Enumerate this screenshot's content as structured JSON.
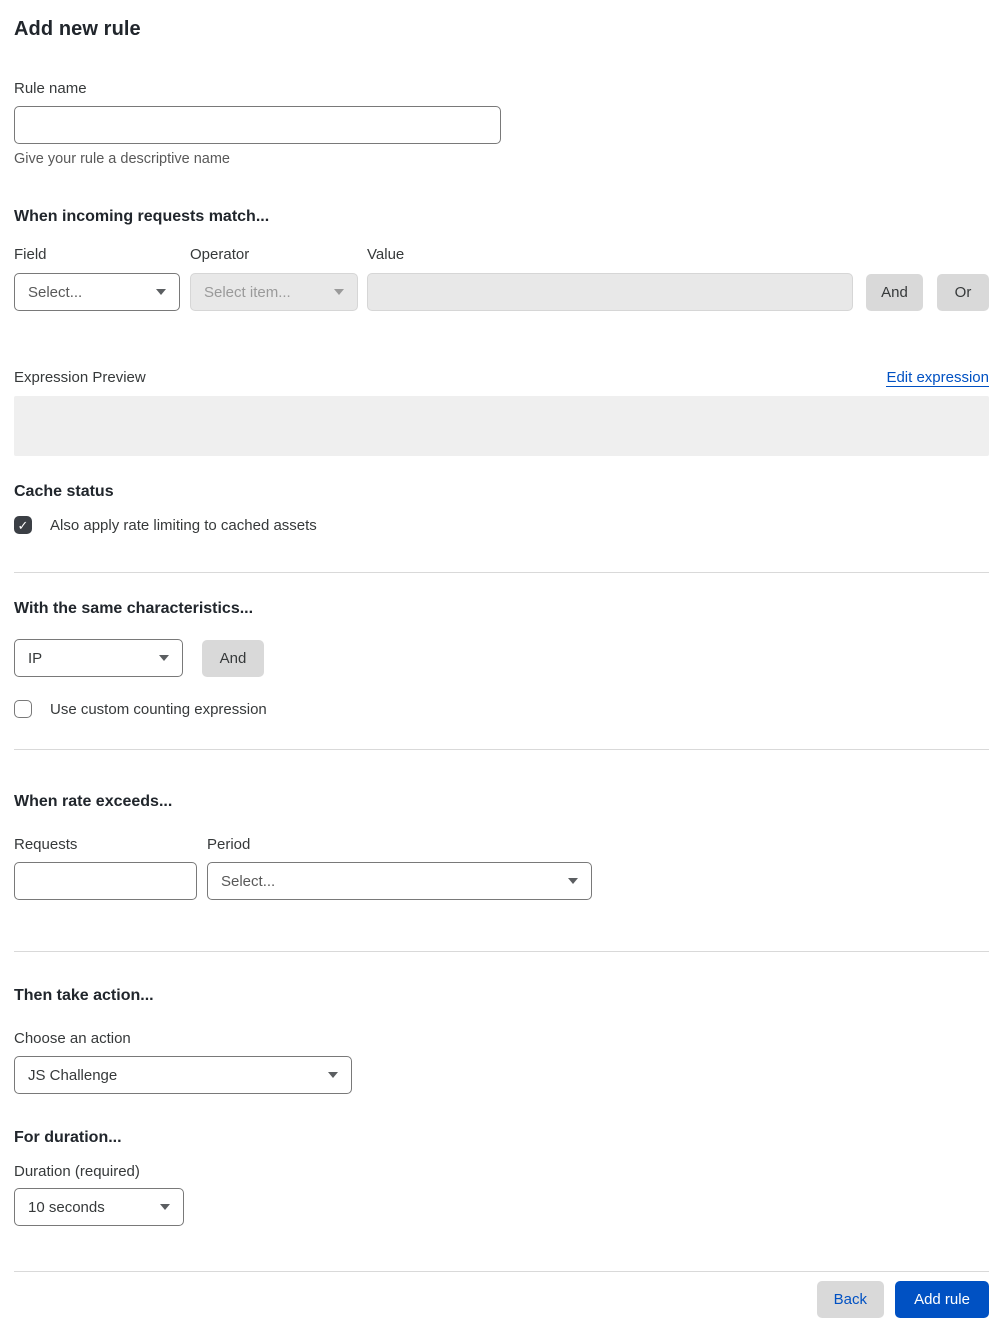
{
  "page": {
    "title": "Add new rule"
  },
  "colors": {
    "accent_blue": "#0051c3",
    "button_gray": "#d9d9d9",
    "checkbox_checked": "#3b3f45",
    "divider_gray": "#d9d9d9",
    "preview_bg": "#efefef"
  },
  "icons": {
    "check_icon": "✓"
  },
  "rule_name": {
    "label": "Rule name",
    "value": "",
    "helper": "Give your rule a descriptive name"
  },
  "match": {
    "heading": "When incoming requests match...",
    "field": {
      "label": "Field",
      "selected": "Select..."
    },
    "operator": {
      "label": "Operator",
      "selected": "Select item...",
      "disabled": true
    },
    "value": {
      "label": "Value",
      "value": "",
      "disabled": true
    },
    "and_button": "And",
    "or_button": "Or",
    "expression_preview_label": "Expression Preview",
    "edit_expression_link": "Edit expression",
    "preview_value": ""
  },
  "cache_status": {
    "heading": "Cache status",
    "checkbox_label": "Also apply rate limiting to cached assets",
    "checked": true
  },
  "characteristics": {
    "heading": "With the same characteristics...",
    "select_selected": "IP",
    "and_button": "And",
    "counting_checkbox_label": "Use custom counting expression",
    "counting_checked": false
  },
  "rate": {
    "heading": "When rate exceeds...",
    "requests": {
      "label": "Requests",
      "value": ""
    },
    "period": {
      "label": "Period",
      "selected": "Select..."
    }
  },
  "action": {
    "heading": "Then take action...",
    "label": "Choose an action",
    "selected": "JS Challenge"
  },
  "duration": {
    "heading": "For duration...",
    "label": "Duration (required)",
    "selected": "10 seconds"
  },
  "footer": {
    "back_button": "Back",
    "submit_button": "Add rule"
  }
}
